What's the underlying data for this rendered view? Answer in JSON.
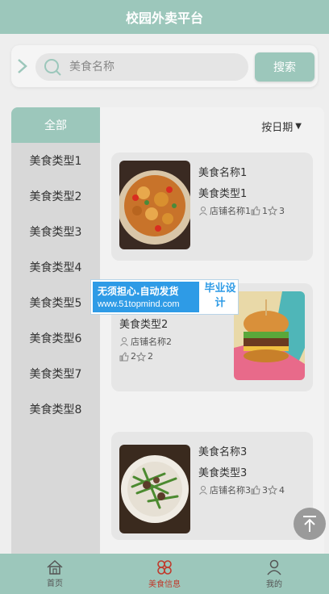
{
  "header": {
    "title": "校园外卖平台"
  },
  "search": {
    "placeholder": "美食名称",
    "button_label": "搜索"
  },
  "categories": {
    "all_label": "全部",
    "items": [
      "美食类型1",
      "美食类型2",
      "美食类型3",
      "美食类型4",
      "美食类型5",
      "美食类型6",
      "美食类型7",
      "美食类型8"
    ]
  },
  "sort": {
    "label": "按日期"
  },
  "foods": [
    {
      "name": "美食名称1",
      "type": "美食类型1",
      "shop": "店铺名称1",
      "likes": "1",
      "favorites": "3"
    },
    {
      "name": "",
      "type": "美食类型2",
      "shop": "店铺名称2",
      "likes": "2",
      "favorites": "2"
    },
    {
      "name": "美食名称3",
      "type": "美食类型3",
      "shop": "店铺名称3",
      "likes": "3",
      "favorites": "4"
    }
  ],
  "watermark": {
    "line1": "无须担心.自动发货",
    "line2": "www.51topmind.com",
    "right": "毕业设计"
  },
  "tabbar": {
    "items": [
      "首页",
      "美食信息",
      "我的"
    ]
  },
  "colors": {
    "accent": "#9cc7bb",
    "active_tab": "#c0392b",
    "banner_blue": "#2e9be6"
  }
}
